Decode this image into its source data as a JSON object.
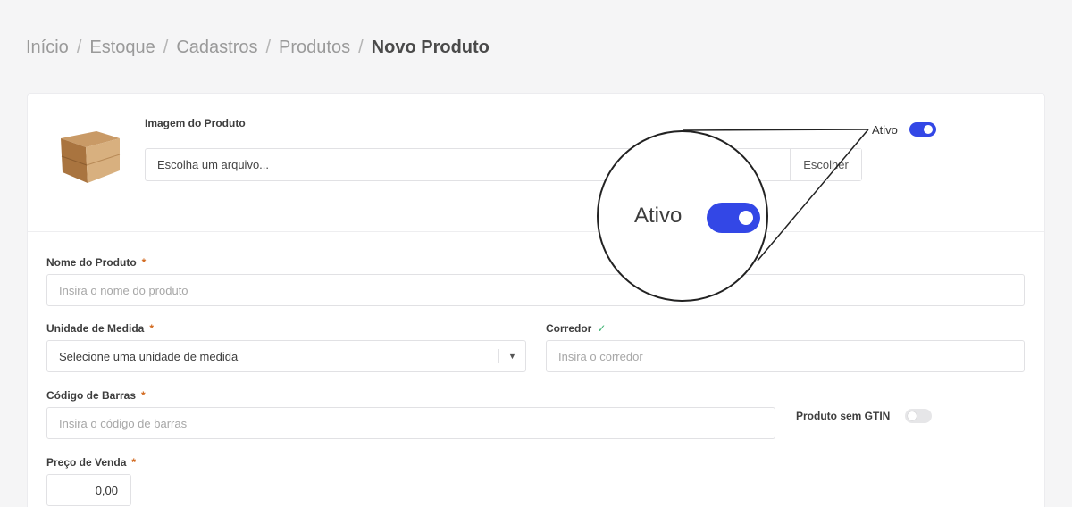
{
  "breadcrumb": {
    "items": [
      "Início",
      "Estoque",
      "Cadastros",
      "Produtos"
    ],
    "separator": "/",
    "current": "Novo Produto"
  },
  "image": {
    "label": "Imagem do Produto",
    "file_placeholder": "Escolha um arquivo...",
    "choose_button": "Escolher",
    "thumbnail_icon": "cardboard-box-icon"
  },
  "active": {
    "label": "Ativo",
    "enabled": true
  },
  "magnifier": {
    "label": "Ativo",
    "enabled": true
  },
  "form": {
    "nome": {
      "label": "Nome do Produto",
      "required": "*",
      "placeholder": "Insira o nome do produto"
    },
    "unidade": {
      "label": "Unidade de Medida",
      "required": "*",
      "value": "Selecione uma unidade de medida"
    },
    "corredor": {
      "label": "Corredor",
      "valid_mark": "✓",
      "placeholder": "Insira o corredor"
    },
    "codigo": {
      "label": "Código de Barras",
      "required": "*",
      "placeholder": "Insira o código de barras"
    },
    "sem_gtin": {
      "label": "Produto sem GTIN",
      "enabled": false
    },
    "preco": {
      "label": "Preço de Venda",
      "required": "*",
      "value": "0,00"
    }
  },
  "colors": {
    "accent": "#3347e6",
    "required": "#d2691e",
    "valid": "#3cb371"
  }
}
